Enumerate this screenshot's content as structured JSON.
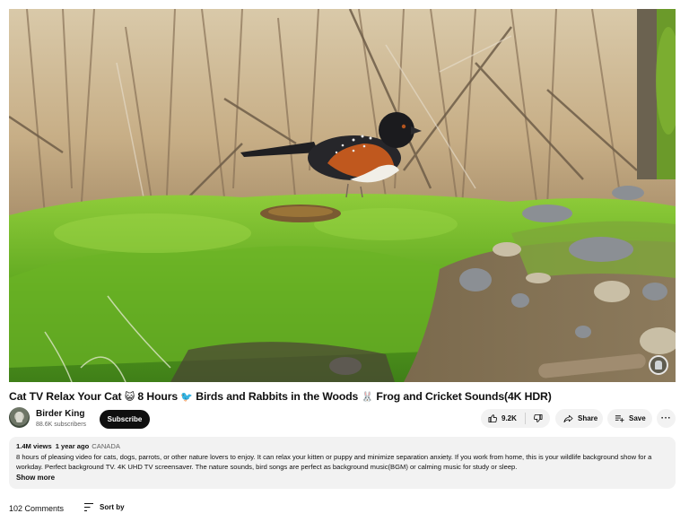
{
  "video": {
    "scene_description": "Spotted towhee on green moss with stones, dry branches in background",
    "watermark_icon": "channel-watermark-icon"
  },
  "title": {
    "part1": "Cat TV Relax Your Cat ",
    "emoji_cat": "😺",
    "part2": " 8 Hours ",
    "emoji_bird": "🐦",
    "part3": " Birds and Rabbits in the Woods ",
    "emoji_rabbit": "🐰",
    "part4": " Frog and Cricket Sounds(4K HDR)"
  },
  "channel": {
    "name": "Birder King",
    "subscribers": "88.6K subscribers",
    "subscribe_label": "Subscribe"
  },
  "actions": {
    "like_icon": "thumbs-up-icon",
    "like_count": "9.2K",
    "dislike_icon": "thumbs-down-icon",
    "share_label": "Share",
    "share_icon": "share-arrow-icon",
    "save_label": "Save",
    "save_icon": "playlist-add-icon",
    "more_label": "···",
    "more_icon": "more-horizontal-icon"
  },
  "description": {
    "views": "1.4M views",
    "time_ago": "1 year ago",
    "location": "CANADA",
    "text": "8 hours of pleasing video for cats, dogs, parrots, or other nature lovers to enjoy. It can relax your kitten or puppy and minimize separation anxiety. If you work from home, this is your wildlife background show for a workday. Perfect background TV. 4K UHD TV screensaver. The nature sounds, bird songs are perfect as background music(BGM) or calming music for study or sleep.",
    "show_more_label": "Show more"
  },
  "comments": {
    "count_label": "102 Comments",
    "sort_label": "Sort by",
    "sort_icon": "sort-icon"
  },
  "colors": {
    "subscribe_bg": "#0f0f0f",
    "pill_bg": "#f2f2f2",
    "secondary_text": "#606060"
  }
}
